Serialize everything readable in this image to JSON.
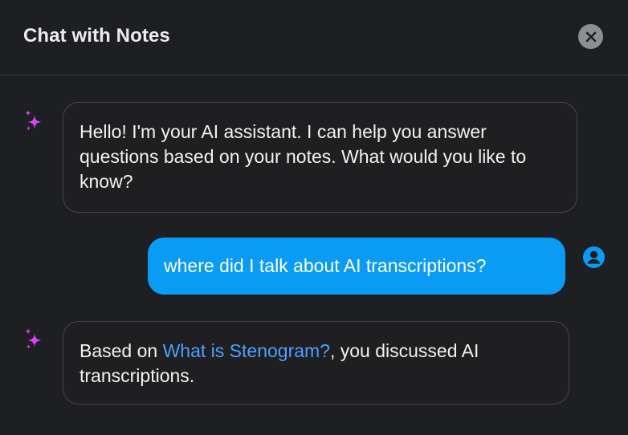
{
  "window": {
    "title": "Chat with Notes",
    "close_icon": "close-icon"
  },
  "colors": {
    "background": "#1e1f23",
    "user_bubble": "#0a9cf5",
    "ai_bubble_border": "#46474c",
    "link": "#4aa2ff",
    "sparkle": "#e040fb",
    "close_button": "#8e8f93"
  },
  "messages": [
    {
      "role": "assistant",
      "icon": "sparkle-icon",
      "text": "Hello! I'm your AI assistant. I can help you answer questions based on your notes. What would you like to know?"
    },
    {
      "role": "user",
      "icon": "user-avatar-icon",
      "text": "where did I talk about AI transcriptions?"
    },
    {
      "role": "assistant",
      "icon": "sparkle-icon",
      "prefix": "Based on ",
      "link": "What is Stenogram?",
      "suffix": ", you discussed AI transcriptions."
    }
  ]
}
